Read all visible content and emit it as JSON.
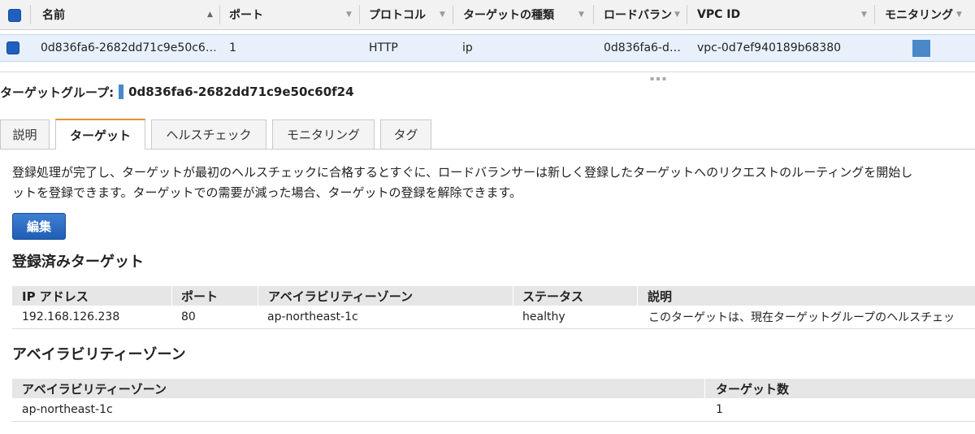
{
  "grid": {
    "columns": [
      "名前",
      "ポート",
      "プロトコル",
      "ターゲットの種類",
      "ロードバラン",
      "VPC ID",
      "モニタリング"
    ],
    "row": {
      "name": "0d836fa6-2682dd71c9e50c6…",
      "port": "1",
      "protocol": "HTTP",
      "target_type": "ip",
      "load_balancer": "0d836fa6-d…",
      "vpc_id": "vpc-0d7ef940189b68380"
    }
  },
  "target_group": {
    "label": "ターゲットグループ:",
    "name": "0d836fa6-2682dd71c9e50c60f24"
  },
  "tabs": [
    "説明",
    "ターゲット",
    "ヘルスチェック",
    "モニタリング",
    "タグ"
  ],
  "active_tab": "ターゲット",
  "description": {
    "line1": "登録処理が完了し、ターゲットが最初のヘルスチェックに合格するとすぐに、ロードバランサーは新しく登録したターゲットへのリクエストのルーティングを開始し",
    "line2": "ットを登録できます。ターゲットでの需要が減った場合、ターゲットの登録を解除できます。"
  },
  "edit_button": "編集",
  "registered": {
    "title": "登録済みターゲット",
    "headers": [
      "IP アドレス",
      "ポート",
      "アベイラビリティーゾーン",
      "ステータス",
      "説明"
    ],
    "rows": [
      [
        "192.168.126.238",
        "80",
        "ap-northeast-1c",
        "healthy",
        "このターゲットは、現在ターゲットグループのヘルスチェッ"
      ]
    ]
  },
  "az": {
    "title": "アベイラビリティーゾーン",
    "headers": [
      "アベイラビリティーゾーン",
      "ターゲット数"
    ],
    "rows": [
      [
        "ap-northeast-1c",
        "1"
      ]
    ]
  },
  "colors": {
    "accent": "#1f5fbf",
    "tab_active": "#e8912d",
    "selected_row": "#e8f1fb"
  }
}
